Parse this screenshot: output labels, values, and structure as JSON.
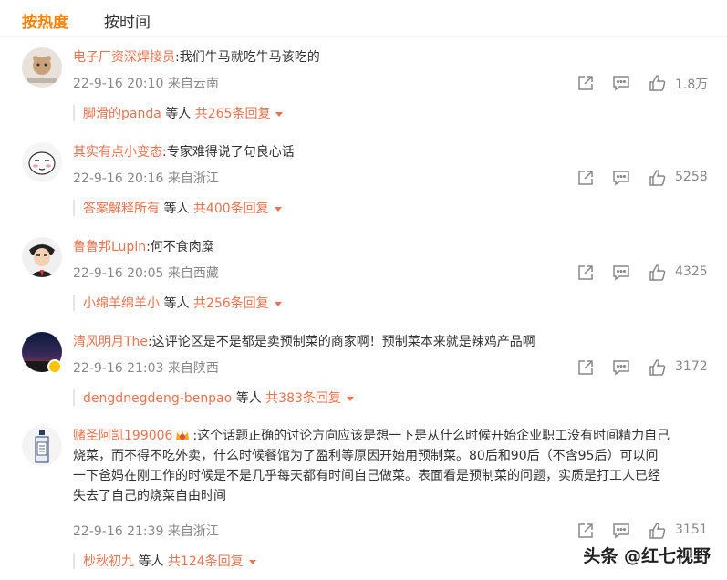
{
  "tabs": {
    "hot": "按热度",
    "time": "按时间"
  },
  "comments": [
    {
      "user": "电子厂资深焊接员",
      "text": ":我们牛马就吃牛马该吃的",
      "meta": "22-9-16 20:10 来自云南",
      "likes": "1.8万",
      "reply_user": "脚滑的panda",
      "reply_mid": " 等人 ",
      "reply_count": "共265条回复"
    },
    {
      "user": "其实有点小变态",
      "text": ":专家难得说了句良心话",
      "meta": "22-9-16 20:16 来自浙江",
      "likes": "5258",
      "reply_user": "答案解释所有",
      "reply_mid": " 等人 ",
      "reply_count": "共400条回复"
    },
    {
      "user": "鲁鲁邦Lupin",
      "text": ":何不食肉糜",
      "meta": "22-9-16 20:05 来自西藏",
      "likes": "4325",
      "reply_user": "小绵羊绵羊小",
      "reply_mid": " 等人 ",
      "reply_count": "共256条回复"
    },
    {
      "user": "清风明月The",
      "text": ":这评论区是不是都是卖预制菜的商家啊！预制菜本来就是辣鸡产品啊",
      "meta": "22-9-16 21:03 来自陕西",
      "likes": "3172",
      "reply_user": "dengdnegdeng-benpao",
      "reply_mid": " 等人 ",
      "reply_count": "共383条回复"
    },
    {
      "user": "赌圣阿凯199006",
      "text_lines": [
        ":这个话题正确的讨论方向应该是想一下是从什么时候开始企业职工没有时间精力自己",
        "烧菜，而不得不吃外卖，什么时候餐馆为了盈利等原因开始用预制菜。80后和90后（不含95后）可以问",
        "一下爸妈在刚工作的时候是不是几乎每天都有时间自己做菜。表面看是预制菜的问题，实质是打工人已经",
        "失去了自己的烧菜自由时间"
      ],
      "meta": "22-9-16 21:39 来自浙江",
      "likes": "3151",
      "reply_user": "杪秋初九",
      "reply_mid": " 等人 ",
      "reply_count": "共124条回复"
    }
  ],
  "watermark": "头条 @红七视野"
}
